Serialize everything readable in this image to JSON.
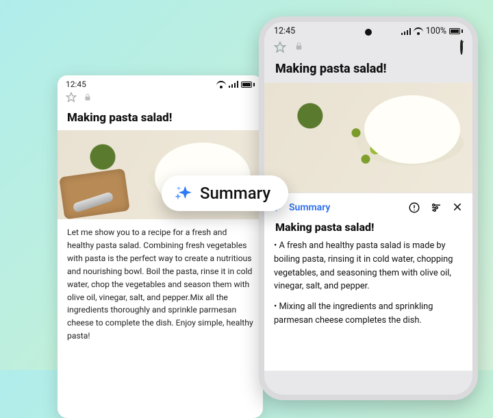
{
  "back": {
    "time": "12:45",
    "title": "Making pasta salad!",
    "article": "Let me show you to a recipe for a fresh and healthy pasta salad. Combining fresh vegetables with pasta is the perfect way to create a nutritious and nourishing bowl. Boil the pasta, rinse it in cold water, chop the vegetables and season them with olive oil, vinegar, salt, and pepper.Mix all the ingredients thoroughly and sprinkle parmesan cheese to complete the dish. Enjoy simple, healthy pasta!"
  },
  "front": {
    "time": "12:45",
    "battery": "100%",
    "title": "Making pasta salad!",
    "summary_label": "Summary",
    "summary_title": "Making pasta salad!",
    "bullet1": "• A fresh and healthy pasta salad is made by boiling pasta, rinsing it in cold water, chopping vegetables, and seasoning them with olive oil, vinegar, salt, and pepper.",
    "bullet2": "• Mixing all the ingredients and sprinkling parmesan cheese completes the dish."
  },
  "pill": {
    "label": "Summary"
  }
}
